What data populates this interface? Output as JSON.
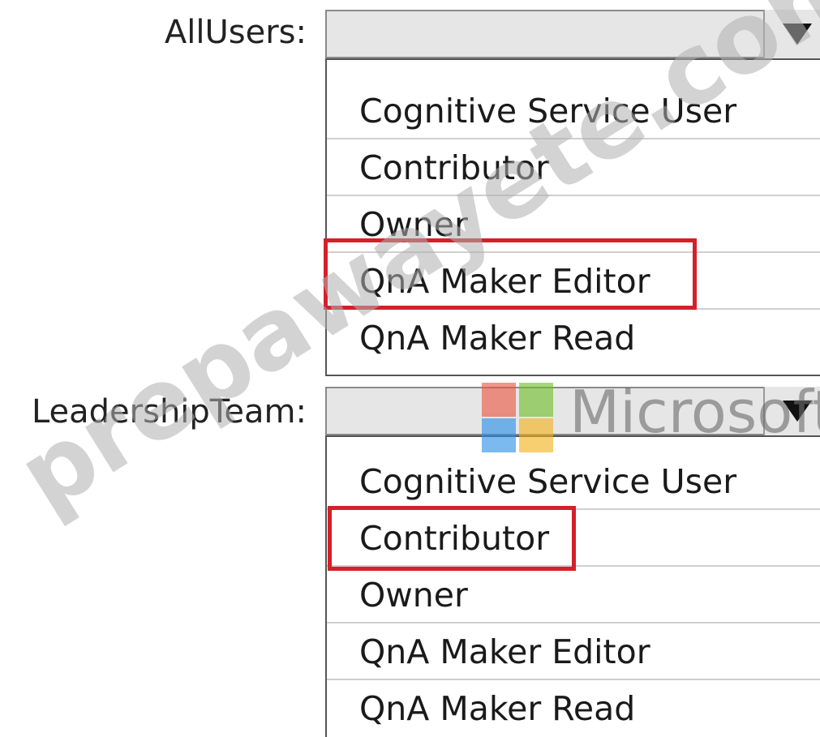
{
  "allusers": {
    "label": "AllUsers:",
    "selected_value": "",
    "options": [
      "Cognitive Service User",
      "Contributor",
      "Owner",
      "QnA Maker Editor",
      "QnA Maker Read"
    ],
    "highlighted_option": "QnA Maker Editor"
  },
  "leadershipteam": {
    "label": "LeadershipTeam:",
    "selected_value": "",
    "options": [
      "Cognitive Service User",
      "Contributor",
      "Owner",
      "QnA Maker Editor",
      "QnA Maker Read"
    ],
    "highlighted_option": "Contributor"
  },
  "overlays": {
    "microsoft_logo_text": "Microsoft",
    "watermark_text": "prepawayete.com"
  },
  "colors": {
    "highlight": "#d4202b",
    "dropdown_bg": "#e6e6e6",
    "logo_red": "#e8553f",
    "logo_green": "#6fbf2b",
    "logo_blue": "#2b8fe8",
    "logo_yellow": "#f3b21b"
  },
  "icons": {
    "dropdown_arrow": "triangle-down-icon",
    "logo": "microsoft-logo-icon"
  }
}
